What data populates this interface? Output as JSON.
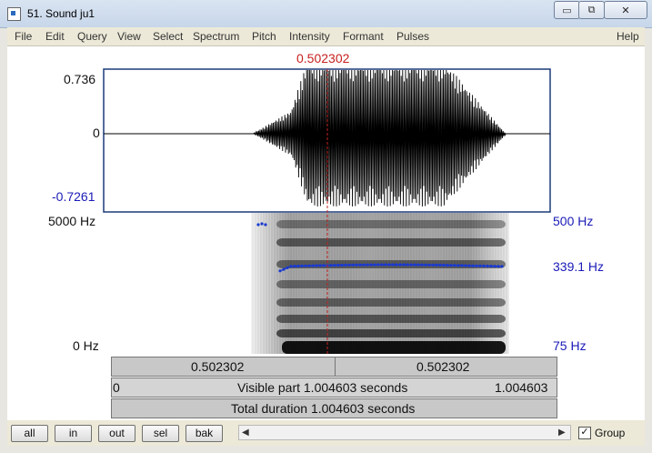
{
  "window": {
    "title": "51. Sound ju1"
  },
  "menu": [
    "File",
    "Edit",
    "Query",
    "View",
    "Select",
    "Spectrum",
    "Pitch",
    "Intensity",
    "Formant",
    "Pulses",
    "Help"
  ],
  "cursor": {
    "time_label": "0.502302"
  },
  "waveform": {
    "y_max": "0.736",
    "y_zero": "0",
    "y_min": "-0.7261"
  },
  "spectrogram": {
    "freq_max": "5000 Hz",
    "freq_min": "0 Hz"
  },
  "pitch": {
    "top": "500 Hz",
    "value": "339.1 Hz",
    "bottom": "75 Hz"
  },
  "time_bar": {
    "left": "0.502302",
    "right": "0.502302"
  },
  "visible_bar": {
    "start": "0",
    "label": "Visible part 1.004603 seconds",
    "end": "1.004603"
  },
  "total_bar": {
    "label": "Total duration 1.004603 seconds"
  },
  "buttons": {
    "all": "all",
    "in": "in",
    "out": "out",
    "sel": "sel",
    "bak": "bak"
  },
  "group": {
    "label": "Group",
    "checked": true
  },
  "colors": {
    "cursor": "#c82020",
    "pitch": "#1a3ad0",
    "axis_label": "#1a1ab8"
  }
}
